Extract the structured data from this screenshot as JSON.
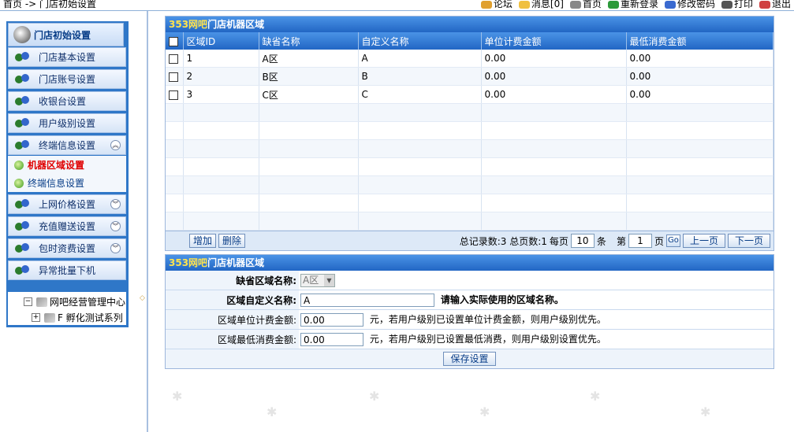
{
  "topbar": {
    "breadcrumb": "首页 -> 门店初始设置",
    "links": [
      {
        "label": "论坛",
        "color": "#e0a030"
      },
      {
        "label": "消息[0]",
        "color": "#f0c040"
      },
      {
        "label": "首页",
        "color": "#888888"
      },
      {
        "label": "重新登录",
        "color": "#2d9a3a"
      },
      {
        "label": "修改密码",
        "color": "#3a6ad0"
      },
      {
        "label": "打印",
        "color": "#555555"
      },
      {
        "label": "退出",
        "color": "#d04040"
      }
    ]
  },
  "sidebar": {
    "header": "门店初始设置",
    "items": [
      {
        "label": "门店基本设置"
      },
      {
        "label": "门店账号设置"
      },
      {
        "label": "收银台设置"
      },
      {
        "label": "用户级别设置"
      },
      {
        "label": "终端信息设置",
        "chevron": "︽"
      }
    ],
    "subitems": [
      {
        "label": "机器区域设置"
      },
      {
        "label": "终端信息设置"
      }
    ],
    "items2": [
      {
        "label": "上网价格设置",
        "chevron": "︾"
      },
      {
        "label": "充值赠送设置",
        "chevron": "︾"
      },
      {
        "label": "包时资费设置",
        "chevron": "︾"
      },
      {
        "label": "异常批量下机"
      }
    ],
    "tree": [
      {
        "toggle": "−",
        "label": "网吧经营管理中心"
      },
      {
        "toggle": "+",
        "label": "F 孵化测试系列"
      }
    ]
  },
  "grid_panel": {
    "title_prefix": "353网吧",
    "title_rest": "门店机器区域",
    "columns": [
      "区域ID",
      "缺省名称",
      "自定义名称",
      "单位计费金额",
      "最低消费金额"
    ],
    "rows": [
      {
        "id": "1",
        "default": "A区",
        "custom": "A",
        "unit": "0.00",
        "min": "0.00"
      },
      {
        "id": "2",
        "default": "B区",
        "custom": "B",
        "unit": "0.00",
        "min": "0.00"
      },
      {
        "id": "3",
        "default": "C区",
        "custom": "C",
        "unit": "0.00",
        "min": "0.00"
      }
    ],
    "add_label": "增加",
    "delete_label": "删除",
    "total_text": "总记录数:3 总页数:1",
    "per_page_label": "每页",
    "per_page_value": "10",
    "per_page_unit": "条",
    "page_label": "第",
    "page_value": "1",
    "page_unit": "页",
    "go_label": "Go",
    "prev_label": "上一页",
    "next_label": "下一页"
  },
  "form_panel": {
    "title_prefix": "353网吧",
    "title_rest": "门店机器区域",
    "default_name_label": "缺省区域名称:",
    "default_name_value": "A区",
    "custom_name_label": "区域自定义名称:",
    "custom_name_value": "A",
    "custom_name_hint": "请输入实际使用的区域名称。",
    "unit_label": "区域单位计费金额:",
    "unit_value": "0.00",
    "unit_hint": "元，若用户级别已设置单位计费金额，则用户级别优先。",
    "min_label": "区域最低消费金额:",
    "min_value": "0.00",
    "min_hint": "元，若用户级别已设置最低消费，则用户级别设置优先。",
    "save_label": "保存设置"
  }
}
